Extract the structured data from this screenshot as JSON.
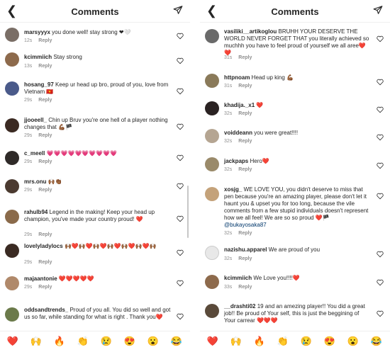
{
  "header": {
    "title": "Comments"
  },
  "left": {
    "comments": [
      {
        "user": "marsyyyx",
        "text": "you done well! stay strong ❤🤍",
        "time": "12s",
        "reply": "Reply"
      },
      {
        "user": "kcimmiich",
        "text": "Stay strong",
        "time": "13s",
        "reply": "Reply"
      },
      {
        "user": "hosang_97",
        "text": "Keep ur head up bro, proud of you, love from Vietnam 🇻🇳",
        "time": "29s",
        "reply": "Reply"
      },
      {
        "user": "jjooeell_",
        "text": "Chin up Bruv you're one hell of a player nothing changes that 💪🏾🏴",
        "time": "29s",
        "reply": "Reply"
      },
      {
        "user": "c_meell",
        "text": "💗💗💗💗💗💗💗💗💗💗",
        "time": "29s",
        "reply": "Reply"
      },
      {
        "user": "mrs.onu",
        "text": "🙌🏾👏🏾",
        "time": "29s",
        "reply": "Reply"
      },
      {
        "user": "rahulb94",
        "text": "Legend in the making! Keep your head up champion, you've made your country proud! ❤️",
        "time": "29s",
        "reply": "Reply"
      },
      {
        "user": "lovelyladylocs",
        "text": "🙌🏾❤️🙌🏾❤️🙌🏾❤️🙌🏾❤️🙌🏾❤️🙌🏾❤️🙌🏾",
        "time": "29s",
        "reply": "Reply"
      },
      {
        "user": "majaantonie",
        "text": "❤️❤️❤️❤️❤️",
        "time": "29s",
        "reply": "Reply"
      },
      {
        "user": "oddsandtrends_",
        "text": "Proud of you all. You did so well and got us so far, while standing for what is right . Thank you❤️",
        "time": "",
        "reply": ""
      }
    ]
  },
  "right": {
    "comments": [
      {
        "user": "vasiliki__artikoglou",
        "text": "BRUHH YOUR DESERVE THE WORLD NEVER FORGET THAT you literally achieved so muchhh you have to feel proud of yourself we all aree❤️❤️",
        "time": "31s",
        "reply": "Reply"
      },
      {
        "user": "httpnoam",
        "text": "Head up king 💪🏾",
        "time": "31s",
        "reply": "Reply"
      },
      {
        "user": "khadija._x1",
        "text": "❤️",
        "time": "32s",
        "reply": "Reply"
      },
      {
        "user": "voiddeann",
        "text": "you were great!!!!",
        "time": "32s",
        "reply": "Reply"
      },
      {
        "user": "jackpaps",
        "text": "Hero❤️",
        "time": "32s",
        "reply": "Reply"
      },
      {
        "user": "xosjg_",
        "text": "WE LOVE YOU, you didn't deserve to miss that pen because you're an amazing player, please don't let it haunt you & upset you for too long, because the vile comments from a few stupid individuals doesn't represent how we all feel! We are so so proud ❤️🏴",
        "mention": "@bukayosaka87",
        "time": "32s",
        "reply": "Reply"
      },
      {
        "user": "nazishu.apparel",
        "text": "We are proud of you",
        "time": "32s",
        "reply": "Reply"
      },
      {
        "user": "kcimmiich",
        "text": "We Love you!!!!❤️",
        "time": "33s",
        "reply": "Reply"
      },
      {
        "user": "__drashti02",
        "text": "19 and an amezing player!! You did a great  job!! Be proud of Your self, this is just the beggining of Your  carrear ❤️❤️❤️",
        "time": "",
        "reply": ""
      }
    ]
  },
  "emojis": [
    "❤️",
    "🙌",
    "🔥",
    "👏",
    "😢",
    "😍",
    "😮",
    "😂"
  ],
  "colors": {
    "heart_red": "#ed4956",
    "meta_gray": "#8e8e8e",
    "text": "#262626",
    "link": "#00376b"
  }
}
